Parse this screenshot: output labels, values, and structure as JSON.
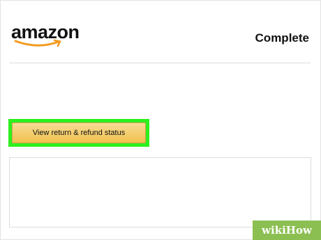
{
  "header": {
    "logo_text": "amazon",
    "status_label": "Complete"
  },
  "actions": {
    "view_return_label": "View return & refund status"
  },
  "colors": {
    "button_top": "#f8dc96",
    "button_bottom": "#f0c14b",
    "highlight": "#2df01e",
    "logo_smile": "#f29a1f",
    "watermark_bg": "#8cbf52"
  },
  "watermark": {
    "text": "wikiHow"
  }
}
